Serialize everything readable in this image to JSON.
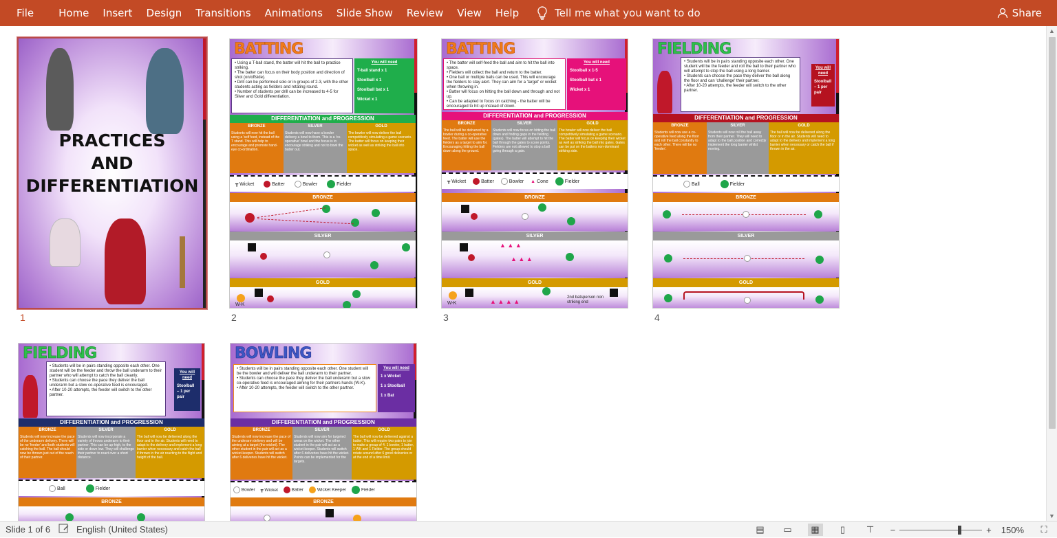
{
  "ribbon": {
    "tabs": [
      "File",
      "Home",
      "Insert",
      "Design",
      "Transitions",
      "Animations",
      "Slide Show",
      "Review",
      "View",
      "Help"
    ],
    "tell_me": "Tell me what you want to do",
    "share": "Share"
  },
  "slides": [
    {
      "number": "1",
      "title_lines": [
        "PRACTICES",
        "AND",
        "DIFFERENTIATION"
      ]
    },
    {
      "number": "2",
      "title": "BATTING",
      "bullets": [
        "Using a T-ball stand, the batter will hit the ball to practice striking.",
        "The batter can focus on their body position and direction of shot (on/offside).",
        "Drill can be performed solo or in groups of 2-3, with the other students acting as fielders and rotating round.",
        "Number of students per drill can be increased to 4-5 for Silver and Gold differentiation."
      ],
      "need_title": "You will need",
      "need": [
        "T-ball stand x 1",
        "Stoolball x 1",
        "Stoolball bat x 1",
        "Wicket x 1"
      ],
      "dp": "DIFFERENTIATION and PROGRESSION",
      "levels": [
        "BRONZE",
        "SILVER",
        "GOLD"
      ],
      "cols": [
        "Students will now hit the ball using a 'self feed, instead of the T stand. This will help to encourage and promote hand-eye co-ordination.",
        "Students will now have a bowler delivery a bowl to them. This is a 'co-operative' bowl and the focus is to encourage striking and not to bowl the batter out.",
        "The bowler will now deliver the ball competitively simulating a game scenario. The batter will focus on keeping their wicket as well as striking the ball into space."
      ],
      "key": [
        "Wicket",
        "Batter",
        "Bowler",
        "Fielder"
      ],
      "zones": [
        "BRONZE",
        "SILVER",
        "GOLD"
      ],
      "wk": "W-K"
    },
    {
      "number": "3",
      "title": "BATTING",
      "bullets": [
        "The batter will self-feed the ball and aim to hit the ball into space.",
        "Fielders will collect the ball and return to the batter.",
        "One ball or multiple balls can be used. This will encourage the fielders to stay alert. They can aim for a 'target' or wicket when throwing in.",
        "Batter will focus on hitting the ball down and through and not up.",
        "Can be adapted to focus on catching - the batter will be encouraged to hit up instead of down."
      ],
      "need_title": "You will need",
      "need": [
        "Stoolball x 1-5",
        "Stoolball bat x 1",
        "Wicket x 1"
      ],
      "dp": "DIFFERENTIATION and PROGRESSION",
      "levels": [
        "BRONZE",
        "SILVER",
        "GOLD"
      ],
      "cols": [
        "The ball will be delivered by a bowler during a co-operative feed. The batter will use the fielders as a target to aim for. Encouraging hitting the ball down along the ground.",
        "Students will now focus on hitting the ball down and finding gaps in the fielding (gates). The batter will attempt to hit the ball through the gates to score points. Fielders are not allowed to stop a ball going through a gate.",
        "The bowler will now deliver the ball competitively simulating a game scenario. The batter will focus on keeping their wicket as well as striking the ball into gates. Gates can be put on the batters non-dominant striking side."
      ],
      "key": [
        "Wicket",
        "Batter",
        "Bowler",
        "Cone",
        "Fielder"
      ],
      "zones": [
        "BRONZE",
        "SILVER",
        "GOLD"
      ],
      "wk": "W-K",
      "note": "2nd batsperson non striking end"
    },
    {
      "number": "4",
      "title": "FIELDING",
      "bullets": [
        "Students will be in pairs standing opposite each other. One student will be the feeder and roll the ball to their partner who will attempt to stop the ball using a long barrier.",
        "Students can choose the pace they deliver the ball along the floor and can 'challenge' their partner.",
        "After 10-20 attempts, the feeder will switch to the other partner."
      ],
      "need_title": "You will need",
      "need": [
        "Stoolball – 1 per pair"
      ],
      "dp": "DIFFERENTIATION and PROGRESSION",
      "levels": [
        "BRONZE",
        "SILVER",
        "GOLD"
      ],
      "cols": [
        "Students will now use a co-operative feed along the floor and roll the ball constantly to each other. There will be no 'feeder'.",
        "Students will now roll the ball away from their partner. They will need to adapt to the ball position and correctly implement the long barrier whilst moving.",
        "The ball will now be delivered along the floor or in the air. Students will need to adapt to the delivery and implement a long barrier when necessary or catch the ball if thrown in the air."
      ],
      "key": [
        "Ball",
        "Fielder"
      ],
      "zones": [
        "BRONZE",
        "SILVER",
        "GOLD"
      ]
    },
    {
      "number": "5",
      "title": "FIELDING",
      "bullets": [
        "Students will be in pairs standing opposite each other. One student will be the feeder and throw the ball underarm to their partner who will attempt to catch the ball cleanly.",
        "Students can choose the pace they deliver the ball underarm but a slow co-operative feed is encouraged.",
        "After 10-20 attempts, the feeder will switch to the other partner."
      ],
      "need_title": "You will need",
      "need": [
        "Stoolball – 1 per pair"
      ],
      "dp": "DIFFERENTIATION and PROGRESSION",
      "levels": [
        "BRONZE",
        "SILVER",
        "GOLD"
      ],
      "cols": [
        "Students will now increase the pace of the underarm delivery. There will be no 'feeder' and both students will catching the ball. The ball should now be thrown just out of the reach of their partner.",
        "Students will now incorporate a variety of throws underarm to their partner. This can be up-high, to the side or down low. They will challenge their partner to react over a short distance.",
        "The ball will now be delivered along the floor and in the air. Students will need to adapt to the delivery and implement a long barrier when necessary and catch the ball if thrown in the air reacting to the flight and height of the ball."
      ],
      "key": [
        "Ball",
        "Fielder"
      ],
      "zones": [
        "BRONZE"
      ]
    },
    {
      "number": "6",
      "title": "BOWLING",
      "bullets": [
        "Students will be in pairs standing opposite each other. One student will be the bowler and will deliver the ball underarm to their partner.",
        "Students can choose the pace they deliver the ball underarm but a slow co-operative feed is encouraged aiming for their partners hands (W-K).",
        "After 10-20 attempts, the feeder will switch to the other partner."
      ],
      "need_title": "You will need",
      "need": [
        "1 x Wicket",
        "1 x Stoolball",
        "1 x Bat"
      ],
      "dp": "DIFFERENTIATION and PROGRESSION",
      "levels": [
        "BRONZE",
        "SILVER",
        "GOLD"
      ],
      "cols": [
        "Students will now increase the pace of the underarm delivery and will be aiming at a target (the wicket). The other student in the pair will act as a wicket-keeper. Students will switch after 6 deliveries have hit the wicket.",
        "Students will now aim for targeted areas on the wicket. The other student in the pair will act as a wicket-keeper. Students will switch after 6 deliveries have hit the wicket. Points can be implemented for the targets.",
        "The ball will now be delivered against a batter. This will require two pairs to join to make a group of 4. 1 bowler, 1 batter, 1 WK and 1 Fielder. The group should rotate around after 6 good deliveries or at the end of a time limit."
      ],
      "key": [
        "Bowler",
        "Wicket",
        "Batter",
        "Wicket Keeper",
        "Fielder"
      ],
      "zones": [
        "BRONZE"
      ]
    }
  ],
  "status": {
    "slide": "Slide 1 of 6",
    "language": "English (United States)",
    "zoom": "150%",
    "zoom_fraction": 0.72
  },
  "colors": {
    "ribbon": "#c34a25",
    "bronze": "#e07a10",
    "silver": "#9a9a9a",
    "gold": "#d49a00"
  }
}
